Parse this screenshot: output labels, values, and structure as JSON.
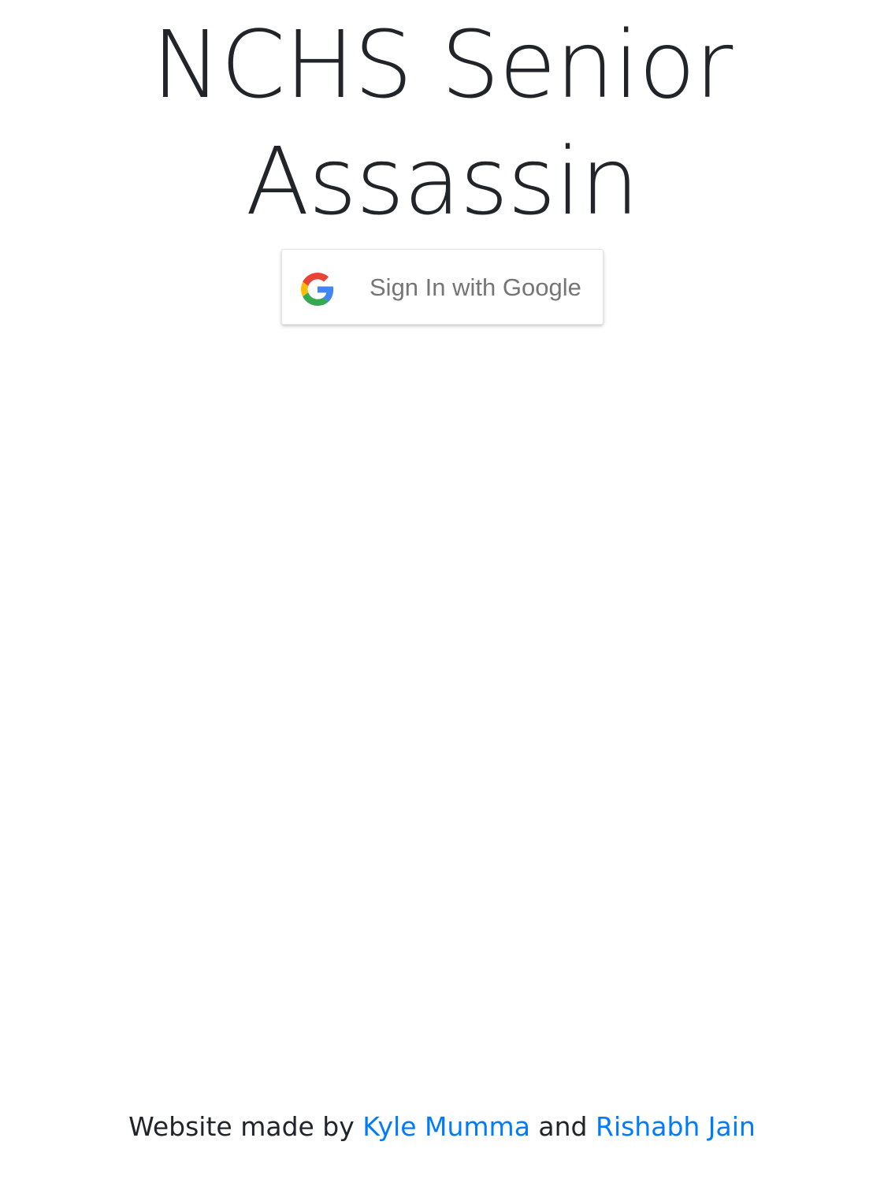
{
  "header": {
    "title_line1": "NCHS Senior",
    "title_line2": "Assassin"
  },
  "signin": {
    "label": "Sign In with Google",
    "icon": "google-g-icon"
  },
  "footer": {
    "prefix": "Website made by",
    "author1": "Kyle Mumma",
    "conjunction": "and",
    "author2": "Rishabh Jain"
  },
  "colors": {
    "text": "#212529",
    "link": "#007bff",
    "button_text": "#757575",
    "google_blue": "#4285F4",
    "google_green": "#34A853",
    "google_yellow": "#FBBC05",
    "google_red": "#EA4335"
  }
}
